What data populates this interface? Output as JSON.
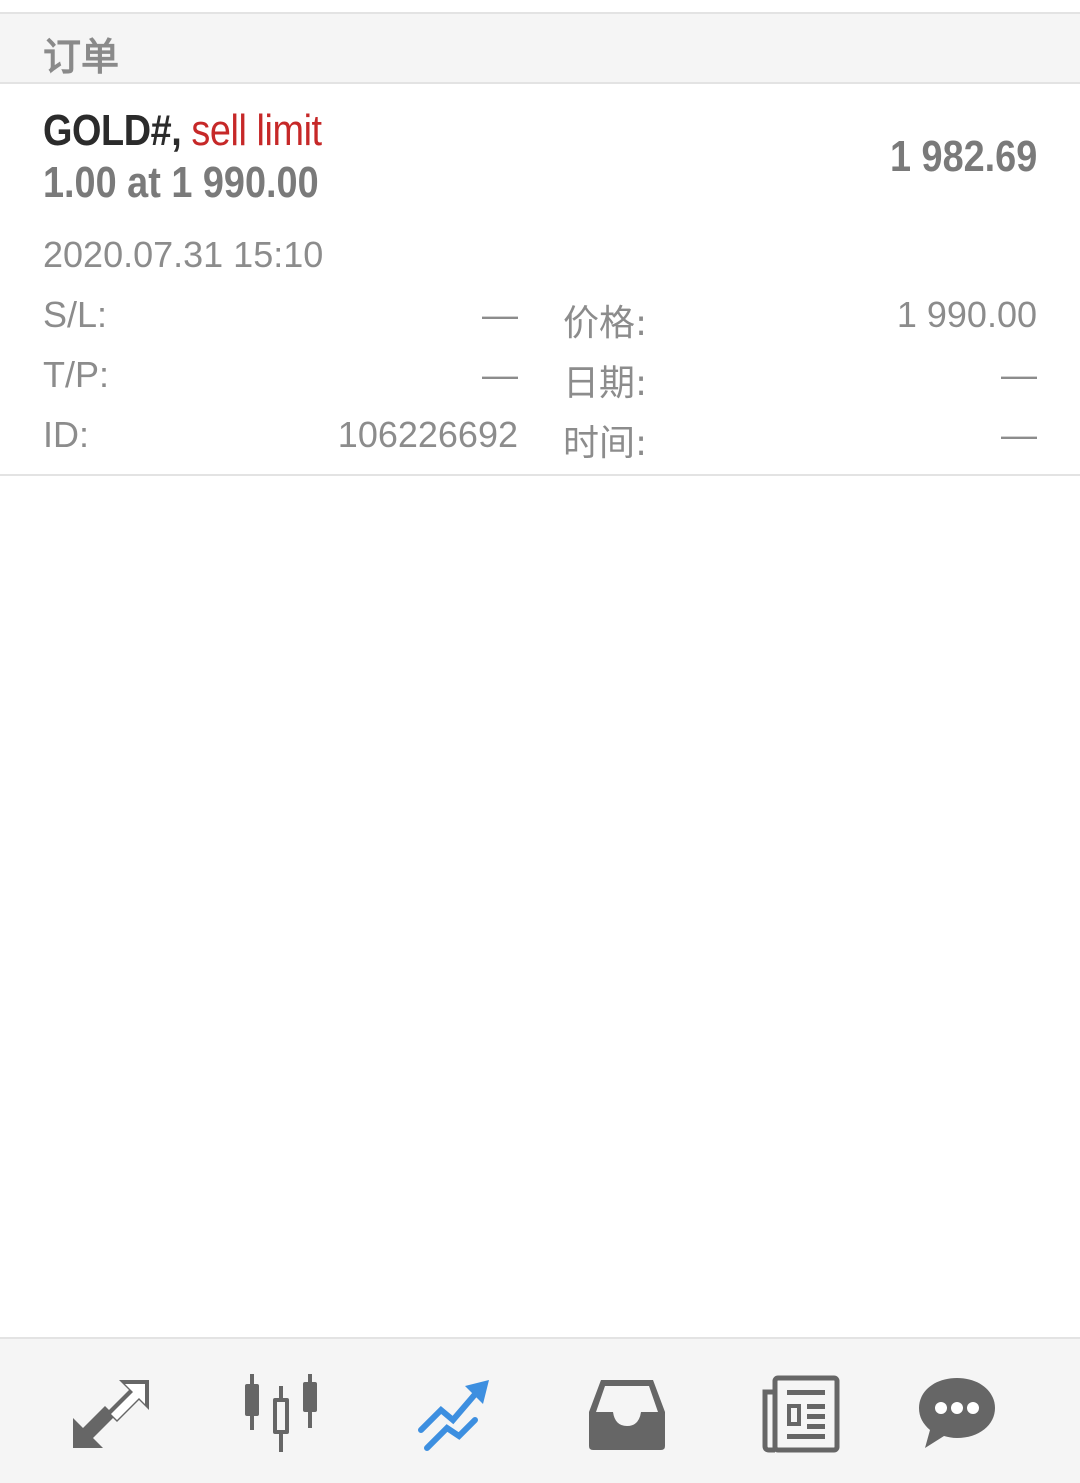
{
  "header": {
    "title": "订单"
  },
  "order": {
    "symbol": "GOLD#,",
    "type": "sell limit",
    "volume_line": "1.00 at 1 990.00",
    "current_price": "1 982.69",
    "timestamp": "2020.07.31 15:10",
    "fields": {
      "sl_label": "S/L:",
      "sl_value": "—",
      "tp_label": "T/P:",
      "tp_value": "—",
      "id_label": "ID:",
      "id_value": "106226692",
      "price_label": "价格:",
      "price_value": "1 990.00",
      "date_label": "日期:",
      "date_value": "—",
      "time_label": "时间:",
      "time_value": "—"
    }
  },
  "colors": {
    "accent": "#3d8fe0",
    "sell": "#c62828",
    "icon": "#666666"
  },
  "bottom_nav": {
    "items": [
      {
        "icon": "quotes-arrows-icon",
        "active": false
      },
      {
        "icon": "candlestick-chart-icon",
        "active": false
      },
      {
        "icon": "trade-trend-icon",
        "active": true
      },
      {
        "icon": "inbox-history-icon",
        "active": false
      },
      {
        "icon": "news-icon",
        "active": false
      },
      {
        "icon": "chat-bubble-icon",
        "active": false
      }
    ]
  }
}
